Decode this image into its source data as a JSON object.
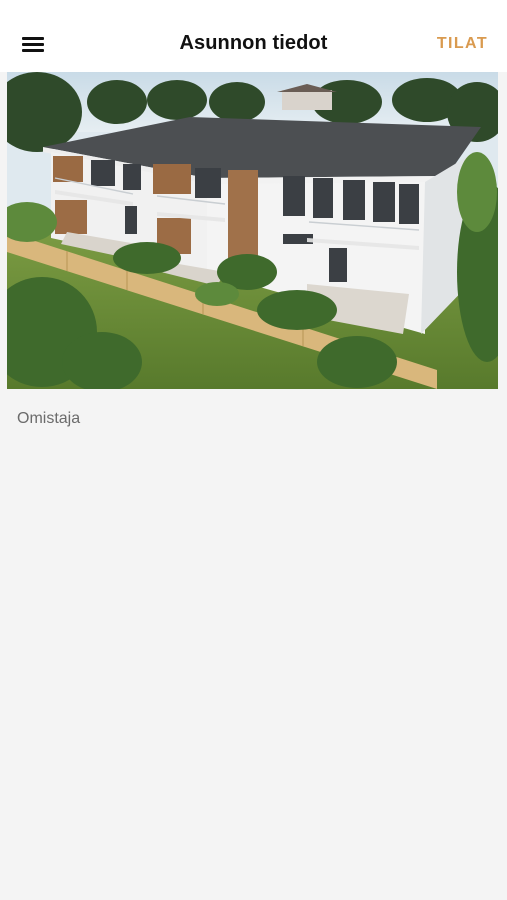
{
  "header": {
    "title": "Asunnon tiedot",
    "action_label": "TILAT"
  },
  "colors": {
    "accent": "#d99a4f",
    "header_bg": "#ffffff",
    "page_bg": "#f4f4f4"
  },
  "hero": {
    "image_name": "building-photo"
  },
  "details": {
    "owner_label": "Omistaja",
    "owner_value": ""
  }
}
